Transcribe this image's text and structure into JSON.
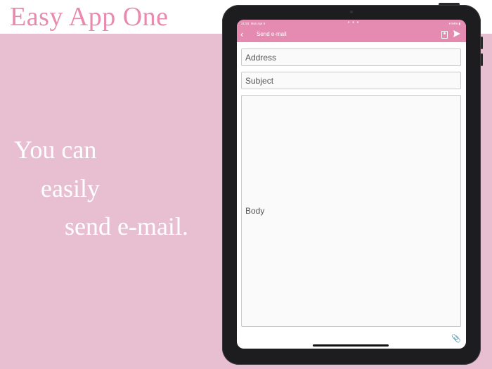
{
  "promo": {
    "app_title": "Easy App One",
    "tagline": [
      "You can",
      "easily",
      "send e-mail."
    ]
  },
  "status_bar": {
    "time": "21:53",
    "date": "Mon Apr 6",
    "dots": "• • •",
    "battery": "94%"
  },
  "nav": {
    "back_icon": "chevron-left-icon",
    "title": "Send e-mail",
    "contacts_icon": "contact-icon",
    "send_icon": "paper-plane-icon"
  },
  "form": {
    "address_placeholder": "Address",
    "subject_placeholder": "Subject",
    "body_placeholder": "Body"
  },
  "footer": {
    "attach_icon": "paperclip-icon"
  },
  "colors": {
    "background": "#e8bfd0",
    "accent": "#e58ab0",
    "title": "#e889ae"
  }
}
